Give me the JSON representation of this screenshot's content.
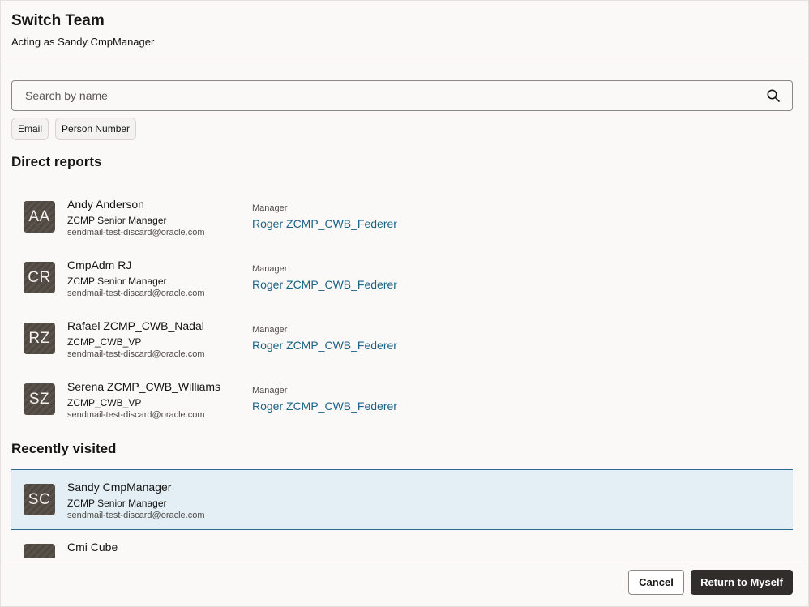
{
  "dialog": {
    "title": "Switch Team",
    "subtitle": "Acting as Sandy CmpManager"
  },
  "search": {
    "placeholder": "Search by name",
    "icon": "search-icon"
  },
  "filters": [
    "Email",
    "Person Number"
  ],
  "direct_reports": {
    "heading": "Direct reports",
    "items": [
      {
        "initials": "AA",
        "name": "Andy Anderson",
        "role": "ZCMP Senior Manager",
        "email": "sendmail-test-discard@oracle.com",
        "manager_label": "Manager",
        "manager": "Roger ZCMP_CWB_Federer"
      },
      {
        "initials": "CR",
        "name": "CmpAdm RJ",
        "role": "ZCMP Senior Manager",
        "email": "sendmail-test-discard@oracle.com",
        "manager_label": "Manager",
        "manager": "Roger ZCMP_CWB_Federer"
      },
      {
        "initials": "RZ",
        "name": "Rafael ZCMP_CWB_Nadal",
        "role": "ZCMP_CWB_VP",
        "email": "sendmail-test-discard@oracle.com",
        "manager_label": "Manager",
        "manager": "Roger ZCMP_CWB_Federer"
      },
      {
        "initials": "SZ",
        "name": "Serena ZCMP_CWB_Williams",
        "role": "ZCMP_CWB_VP",
        "email": "sendmail-test-discard@oracle.com",
        "manager_label": "Manager",
        "manager": "Roger ZCMP_CWB_Federer"
      }
    ]
  },
  "recently_visited": {
    "heading": "Recently visited",
    "items": [
      {
        "initials": "SC",
        "name": "Sandy CmpManager",
        "role": "ZCMP Senior Manager",
        "email": "sendmail-test-discard@oracle.com",
        "selected": true
      },
      {
        "initials": "",
        "name": "Cmi Cube",
        "role": "",
        "email": ""
      }
    ]
  },
  "footer": {
    "cancel_label": "Cancel",
    "return_label": "Return to Myself"
  },
  "colors": {
    "link": "#1a6487",
    "selected_bg": "#e3eff5",
    "selected_border": "#2b6d8f",
    "primary_button": "#312d2a"
  }
}
